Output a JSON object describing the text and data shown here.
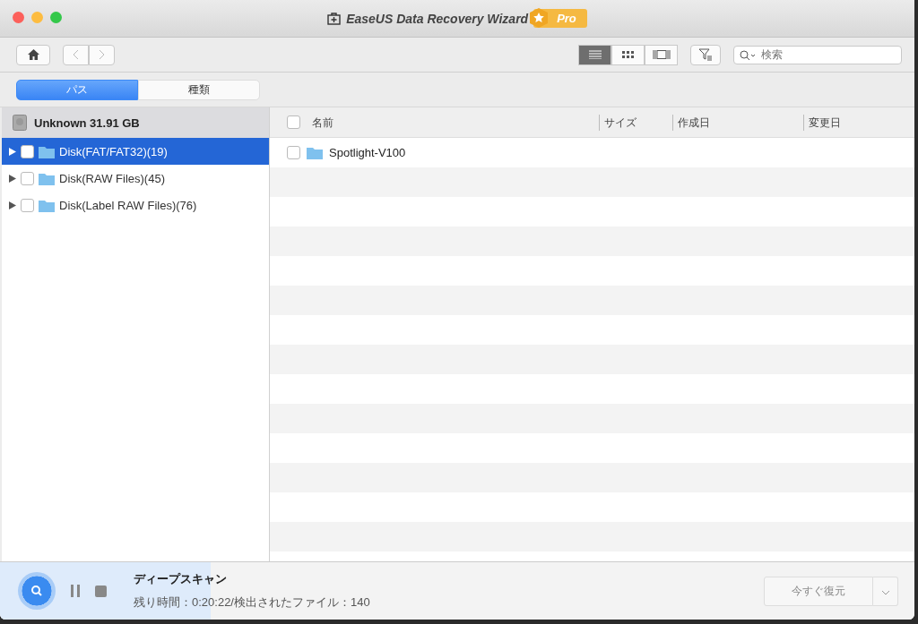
{
  "window": {
    "title": "EaseUS Data Recovery Wizard",
    "badge": "Pro"
  },
  "toolbar": {
    "view_modes": [
      {
        "kind": "list",
        "selected": true
      },
      {
        "kind": "grid",
        "selected": false
      },
      {
        "kind": "cover",
        "selected": false
      }
    ],
    "search": {
      "placeholder": "検索"
    }
  },
  "tabs": [
    {
      "label": "パス",
      "selected": true
    },
    {
      "label": "種類",
      "selected": false
    }
  ],
  "sidebar": {
    "drive": "Unknown 31.91 GB",
    "items": [
      {
        "label": "Disk(FAT/FAT32)(19)",
        "selected": true,
        "checked": false
      },
      {
        "label": "Disk(RAW Files)(45)",
        "selected": false,
        "checked": false
      },
      {
        "label": "Disk(Label RAW Files)(76)",
        "selected": false,
        "checked": false
      }
    ]
  },
  "table": {
    "select_all_checked": false,
    "columns": [
      "名前",
      "サイズ",
      "作成日",
      "変更日"
    ],
    "rows": [
      {
        "name": "Spotlight-V100",
        "checked": false
      }
    ]
  },
  "status_bar": {
    "title": "ディープスキャン",
    "detail": "残り時間：0:20:22/検出されたファイル：140",
    "level": 0.23,
    "restore_button": {
      "label": "今すぐ復元",
      "disabled": true
    }
  }
}
